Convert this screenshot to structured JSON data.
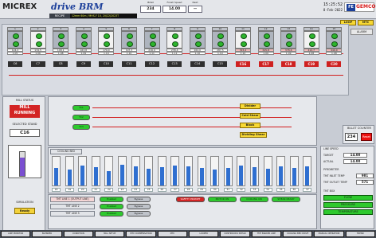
{
  "header": {
    "logo_main": "MICREX",
    "logo_sub": "drive BRM",
    "recipe_label": "RECIPE",
    "recipe_value": "12mm 60m / MHS-F 10, 20/22/2023T",
    "fields": [
      {
        "label": "Billet",
        "value": "234"
      },
      {
        "label": "Finish Speed",
        "value": "14.00"
      },
      {
        "label": "Next",
        "value": "—"
      }
    ],
    "time": "15:25:52",
    "date": "8-Feb-2022",
    "brand_short": "FE",
    "brand": "GEMCO",
    "alarm_label": "ALARM",
    "loop_button": "LOOP",
    "mtc_button": "MTC"
  },
  "mill": {
    "stand_labels": [
      "C6",
      "C7",
      "C8",
      "C9",
      "C10",
      "C11",
      "C12",
      "C13",
      "C14",
      "C15",
      "C16",
      "C17",
      "C18",
      "C19",
      "C20"
    ],
    "stand_nums": [
      "1",
      "2",
      "3",
      "4",
      "5",
      "6",
      "7",
      "8",
      "9",
      "10",
      "11",
      "12",
      "13",
      "14",
      "15"
    ],
    "stand_values": [
      "124.2",
      "134.5",
      "148.1",
      "163.8",
      "179.0",
      "197.3",
      "216.9",
      "238.4",
      "262.0",
      "287.5",
      "315.2",
      "345.8",
      "378.6",
      "412.7",
      "449.0"
    ],
    "stand_values2": [
      "1.05",
      "1.06",
      "1.08",
      "1.09",
      "1.10",
      "1.10",
      "1.11",
      "1.11",
      "1.10",
      "1.10",
      "1.10",
      "1.09",
      "1.09",
      "1.08",
      "1.08"
    ],
    "red_tags": [
      "C16",
      "C17",
      "C18",
      "C19",
      "C20"
    ],
    "mill_status_label": "MILL STATUS",
    "mill_status_value": "MILL RUNNING",
    "selected_label": "SELECTED STAND",
    "selected_value": "C16",
    "gauge_level": 0.78,
    "simulation_label": "SIMULATION",
    "ready_label": "Ready",
    "conveyor_labels": [
      "TC1",
      "TC2",
      "TC3"
    ],
    "divider_labels": [
      "Divider",
      "Cold Shear",
      "Block",
      "Dividing Shear"
    ]
  },
  "center_panel": {
    "cooling_label": "COOLING BED",
    "bar_levels": [
      0.6,
      0.55,
      0.7,
      0.65,
      0.5,
      0.72,
      0.68,
      0.58,
      0.63,
      0.7,
      0.66,
      0.6,
      0.55,
      0.62,
      0.7,
      0.64,
      0.59,
      0.67,
      0.61,
      0.66
    ],
    "speed_values": [
      "18",
      "19",
      "20",
      "21",
      "22",
      "23",
      "24",
      "25",
      "26",
      "27",
      "28",
      "29",
      "30",
      "31",
      "32",
      "33",
      "34",
      "35",
      "36",
      "37"
    ],
    "tmt_lines": [
      "TMT LINE 1 (OUTPUT LINE)",
      "TMT LINE 2",
      "TMT LINE 3"
    ],
    "pills": [
      "Enabled",
      "Enabled",
      "Enabled",
      "Bypass",
      "Bypass",
      "Bypass"
    ],
    "status_flags": [
      "SAFETY PROMPT",
      "MOTOR ON",
      "COOLING ON",
      "SHEAR READY"
    ]
  },
  "right": {
    "billet_counter_label": "BILLET COUNTER",
    "billet_counter_value": "234",
    "billet_counter_reset": "Reset",
    "line_speed_label": "LINE SPEED",
    "target_label": "TARGET",
    "target_value": "14.00",
    "actual_label": "ACTUAL",
    "actual_value": "14.00",
    "pyrometer_label": "PYROMETER",
    "tmt_inlet_label": "TMT INLET TEMP",
    "tmt_inlet_value": "981",
    "tmt_outlet_label": "TMT OUTLET TEMP",
    "tmt_outlet_value": "571",
    "tmt_box_label": "TMT BOX",
    "tmt_box_items": [
      "FLOW",
      "PRESSURE",
      "TEMPERATURE"
    ]
  },
  "footer_buttons": [
    "LINE MONITOR",
    "BLENDER",
    "CONDITION",
    "MILL SETUP",
    "MTC COMPENSATION",
    "MTC",
    "LOOPER",
    "CONTINUOUS SHEAR",
    "TMT BRAKER LINE",
    "COOLING BED DRIVE",
    "MANUAL OPERATION",
    "TREND"
  ],
  "colors": {
    "running": "#d32424",
    "ok": "#2ec92e",
    "accent": "#f7d834",
    "brand": "#1b3f99"
  }
}
